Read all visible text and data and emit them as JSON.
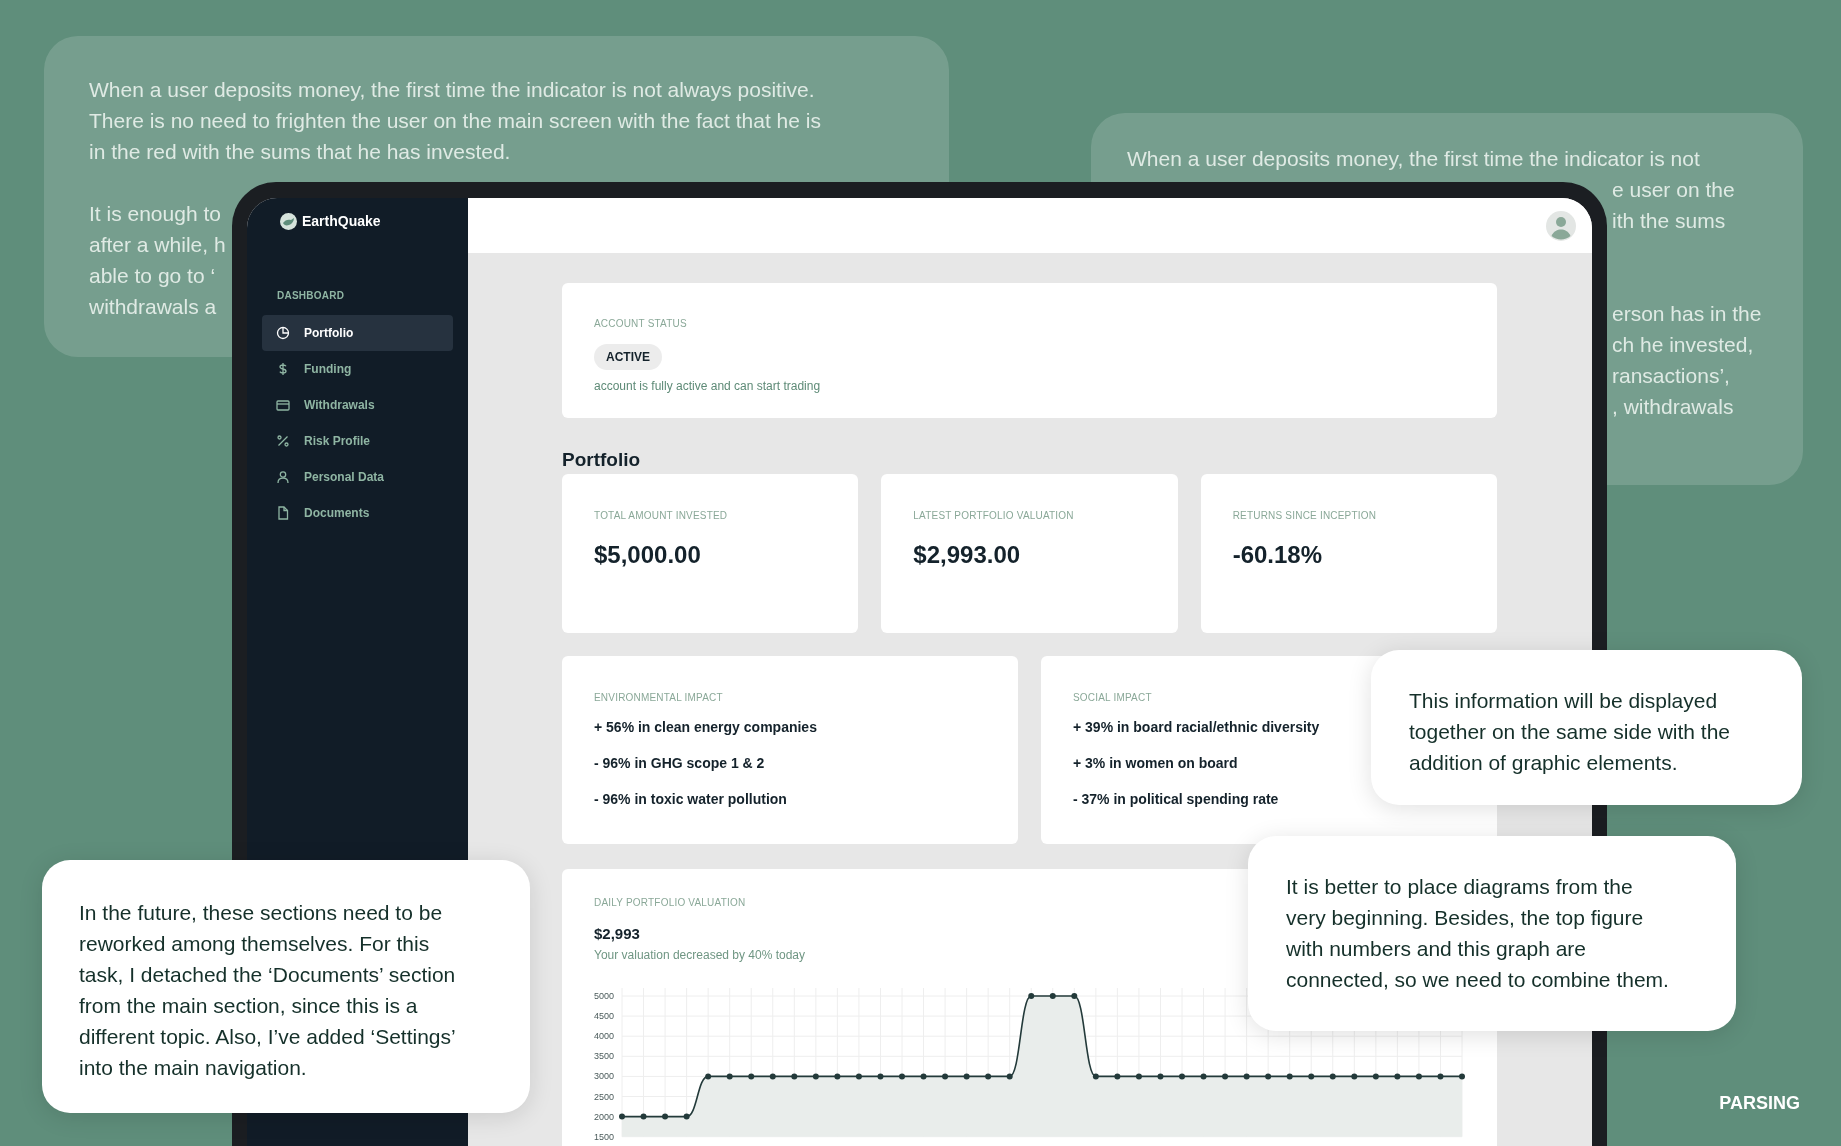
{
  "faded_notes": [
    {
      "paragraphs": [
        [
          {
            "text": "When a user deposits money, the first time the indicator is not always positive.",
            "kind": "full"
          },
          {
            "text": "There is no need to frighten the user on the main screen with the fact that he is",
            "kind": "full"
          },
          {
            "text": "in the red with the sums that he has invested.",
            "kind": "full"
          }
        ],
        [
          {
            "text": "It is enough to",
            "kind": "full"
          },
          {
            "text": "after a while, h",
            "kind": "full"
          },
          {
            "text": "able to go to ‘",
            "kind": "full"
          },
          {
            "text": "withdrawals a",
            "kind": "full"
          }
        ]
      ]
    },
    {
      "paragraphs": [
        [
          {
            "text": "When a user deposits money, the first time the indicator is not",
            "kind": "full"
          },
          {
            "text": "e user on the",
            "kind": "peek"
          },
          {
            "text": "ith the sums",
            "kind": "peek"
          }
        ],
        [
          {
            "text": "erson has in the",
            "kind": "peek"
          },
          {
            "text": "ch he invested,",
            "kind": "peek"
          },
          {
            "text": "ransactions’,",
            "kind": "peek"
          },
          {
            "text": ", withdrawals",
            "kind": "peek"
          }
        ]
      ]
    }
  ],
  "app": {
    "brand": "EarthQuake",
    "nav_section": "DASHBOARD",
    "nav": [
      {
        "label": "Portfolio",
        "selected": true
      },
      {
        "label": "Funding",
        "selected": false
      },
      {
        "label": "Withdrawals",
        "selected": false
      },
      {
        "label": "Risk Profile",
        "selected": false
      },
      {
        "label": "Personal Data",
        "selected": false
      },
      {
        "label": "Documents",
        "selected": false
      }
    ],
    "account_status": {
      "label": "ACCOUNT STATUS",
      "badge": "ACTIVE",
      "description": "account is fully active and can start trading"
    },
    "portfolio_heading": "Portfolio",
    "stats": [
      {
        "label": "TOTAL AMOUNT INVESTED",
        "value": "$5,000.00"
      },
      {
        "label": "LATEST PORTFOLIO VALUATION",
        "value": "$2,993.00"
      },
      {
        "label": "RETURNS SINCE INCEPTION",
        "value": "-60.18%"
      }
    ],
    "impacts": [
      {
        "label": "ENVIRONMENTAL IMPACT",
        "items": [
          "+ 56% in clean energy companies",
          "- 96% in GHG scope 1 & 2",
          "- 96% in toxic water pollution"
        ]
      },
      {
        "label": "SOCIAL IMPACT",
        "items": [
          "+ 39% in board racial/ethnic diversity",
          "+ 3% in women on board",
          "- 37% in political spending rate"
        ]
      }
    ],
    "daily_valuation": {
      "label": "DAILY PORTFOLIO VALUATION",
      "value": "$2,993",
      "subtitle": "Your valuation decreased by 40% today",
      "chart_data": {
        "type": "area",
        "ylim": [
          1500,
          5000
        ],
        "grid": true,
        "yticks": [
          1500,
          2000,
          2500,
          3000,
          3500,
          4000,
          4500,
          5000
        ],
        "series": [
          {
            "color": "#233a3a",
            "values": [
              2000,
              2000,
              2000,
              2000,
              3000,
              3000,
              3000,
              3000,
              3000,
              3000,
              3000,
              3000,
              3000,
              3000,
              3000,
              3000,
              3000,
              3000,
              3000,
              5000,
              5000,
              5000,
              3000,
              3000,
              3000,
              3000,
              3000,
              3000,
              3000,
              3000,
              3000,
              3000,
              3000,
              3000,
              3000,
              3000,
              3000,
              3000,
              3000,
              3000
            ]
          }
        ]
      }
    }
  },
  "callouts": [
    {
      "text": "This information will be displayed together on the same side with the addition of graphic elements."
    },
    {
      "text": "It is better to place diagrams from the very beginning. Besides, the top figure with numbers and this graph are connected, so we need to combine them."
    },
    {
      "text": "In the future, these sections need to be reworked among themselves. For this task, I detached the ‘Documents’ section from the main section, since this is a different topic. Also, I’ve added ‘Settings’ into the main navigation."
    }
  ],
  "footer_label": "PARSING"
}
